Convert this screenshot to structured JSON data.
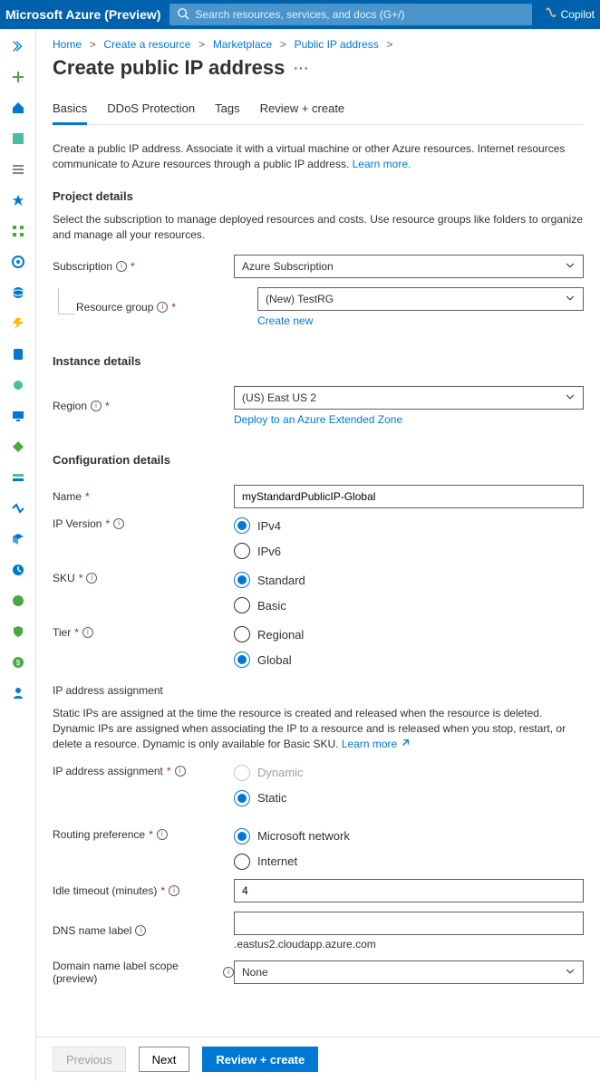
{
  "topbar": {
    "brand": "Microsoft Azure (Preview)",
    "search_placeholder": "Search resources, services, and docs (G+/)",
    "copilot_label": "Copilot"
  },
  "breadcrumb": {
    "home": "Home",
    "create_resource": "Create a resource",
    "marketplace": "Marketplace",
    "public_ip": "Public IP address"
  },
  "page_title": "Create public IP address",
  "tabs": {
    "basics": "Basics",
    "ddos": "DDoS Protection",
    "tags": "Tags",
    "review": "Review + create"
  },
  "intro_text": "Create a public IP address. Associate it with a virtual machine or other Azure resources. Internet resources communicate to Azure resources through a public IP address. ",
  "learn_more": "Learn more.",
  "project_details": {
    "title": "Project details",
    "desc": "Select the subscription to manage deployed resources and costs. Use resource groups like folders to organize and manage all your resources.",
    "subscription_label": "Subscription",
    "subscription_value": "Azure Subscription",
    "resource_group_label": "Resource group",
    "resource_group_value": "(New) TestRG",
    "create_new": "Create new"
  },
  "instance_details": {
    "title": "Instance details",
    "region_label": "Region",
    "region_value": "(US) East US 2",
    "extended_zone_link": "Deploy to an Azure Extended Zone"
  },
  "config": {
    "title": "Configuration details",
    "name_label": "Name",
    "name_value": "myStandardPublicIP-Global",
    "ip_version_label": "IP Version",
    "ipv4": "IPv4",
    "ipv6": "IPv6",
    "sku_label": "SKU",
    "standard": "Standard",
    "basic": "Basic",
    "tier_label": "Tier",
    "regional": "Regional",
    "global": "Global",
    "ip_assign_section": "IP address assignment",
    "ip_assign_desc": "Static IPs are assigned at the time the resource is created and released when the resource is deleted. Dynamic IPs are assigned when associating the IP to a resource and is released when you stop, restart, or delete a resource. Dynamic is only available for Basic SKU. ",
    "learn_more2": "Learn more",
    "ip_assign_label": "IP address assignment",
    "dynamic": "Dynamic",
    "static": "Static",
    "routing_pref_label": "Routing preference",
    "ms_network": "Microsoft network",
    "internet": "Internet",
    "idle_timeout_label": "Idle timeout (minutes)",
    "idle_timeout_value": "4",
    "dns_label": "DNS name label",
    "dns_value": "",
    "dns_suffix": ".eastus2.cloudapp.azure.com",
    "domain_scope_label": "Domain name label scope (preview)",
    "domain_scope_value": "None"
  },
  "footer": {
    "previous": "Previous",
    "next": "Next",
    "review": "Review + create"
  }
}
